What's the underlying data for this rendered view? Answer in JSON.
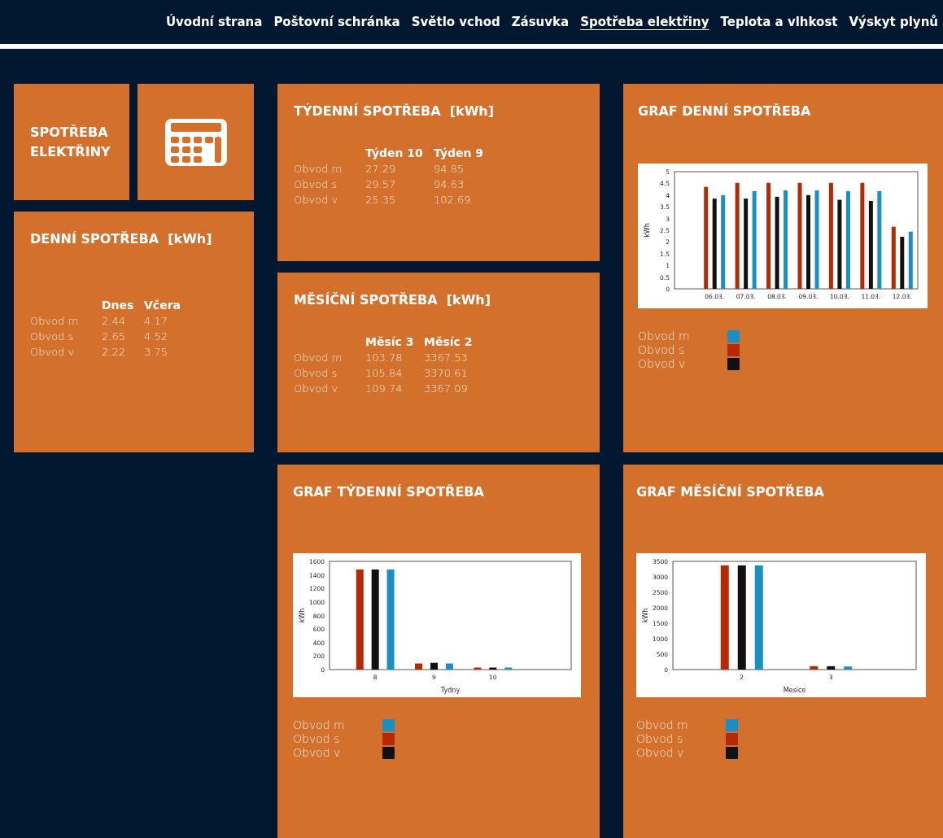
{
  "nav": {
    "items": [
      {
        "label": "Úvodní strana",
        "selected": false
      },
      {
        "label": "Poštovní schránka",
        "selected": false
      },
      {
        "label": "Světlo vchod",
        "selected": false
      },
      {
        "label": "Zásuvka",
        "selected": false
      },
      {
        "label": "Spotřeba elektřiny",
        "selected": true
      },
      {
        "label": "Teplota a vlhkost",
        "selected": false
      },
      {
        "label": "Výskyt plynů",
        "selected": false
      }
    ]
  },
  "page_tile": {
    "title": "SPOTŘEBA ELEKTŘINY"
  },
  "daily": {
    "title": "DENNÍ SPOTŘEBA  [kWh]",
    "columns": [
      "Dnes",
      "Včera"
    ],
    "rows": [
      {
        "label": "Obvod m",
        "values": [
          "2.44",
          "4.17"
        ]
      },
      {
        "label": "Obvod s",
        "values": [
          "2.65",
          "4.52"
        ]
      },
      {
        "label": "Obvod v",
        "values": [
          "2.22",
          "3.75"
        ]
      }
    ]
  },
  "weekly": {
    "title": "TÝDENNÍ SPOTŘEBA  [kWh]",
    "columns": [
      "Týden 10",
      "Týden 9"
    ],
    "rows": [
      {
        "label": "Obvod m",
        "values": [
          "27.29",
          "94.85"
        ]
      },
      {
        "label": "Obvod s",
        "values": [
          "29.57",
          "94.63"
        ]
      },
      {
        "label": "Obvod v",
        "values": [
          "25.35",
          "102.69"
        ]
      }
    ]
  },
  "monthly": {
    "title": "MĚSÍČNÍ SPOTŘEBA  [kWh]",
    "columns": [
      "Měsíc 3",
      "Měsíc 2"
    ],
    "rows": [
      {
        "label": "Obvod m",
        "values": [
          "103.78",
          "3367.53"
        ]
      },
      {
        "label": "Obvod s",
        "values": [
          "105.84",
          "3370.61"
        ]
      },
      {
        "label": "Obvod v",
        "values": [
          "109.74",
          "3367.09"
        ]
      }
    ]
  },
  "daily_chart": {
    "title": "GRAF DENNÍ SPOTŘEBA",
    "chart_data": {
      "type": "bar",
      "ylabel": "kWh",
      "categories": [
        "06.03.",
        "07.03.",
        "08.03.",
        "09.03.",
        "10.03.",
        "11.03.",
        "12.03."
      ],
      "ylim": [
        0,
        5
      ],
      "yticks": [
        0,
        0.5,
        1,
        1.5,
        2,
        2.5,
        3,
        3.5,
        4,
        4.5,
        5
      ],
      "series": [
        {
          "name": "Obvod m",
          "color": "#1a8fc4",
          "values": [
            4.0,
            4.17,
            4.2,
            4.2,
            4.17,
            4.17,
            2.44
          ]
        },
        {
          "name": "Obvod s",
          "color": "#b52a04",
          "values": [
            4.35,
            4.52,
            4.52,
            4.52,
            4.52,
            4.52,
            2.65
          ]
        },
        {
          "name": "Obvod v",
          "color": "#111111",
          "values": [
            3.85,
            3.85,
            3.93,
            4.0,
            3.8,
            3.75,
            2.22
          ]
        }
      ]
    }
  },
  "weekly_chart": {
    "title": "GRAF TÝDENNÍ SPOTŘEBA",
    "chart_data": {
      "type": "bar",
      "xlabel": "Tydny",
      "ylabel": "kWh",
      "categories": [
        "8",
        "9",
        "10"
      ],
      "ylim": [
        0,
        1600
      ],
      "yticks": [
        0,
        200,
        400,
        600,
        800,
        1000,
        1200,
        1400,
        1600
      ],
      "series": [
        {
          "name": "Obvod m",
          "color": "#1a8fc4",
          "values": [
            1480,
            90,
            30
          ]
        },
        {
          "name": "Obvod s",
          "color": "#b52a04",
          "values": [
            1480,
            90,
            30
          ]
        },
        {
          "name": "Obvod v",
          "color": "#111111",
          "values": [
            1480,
            100,
            30
          ]
        }
      ]
    }
  },
  "monthly_chart": {
    "title": "GRAF MĚSÍČNÍ SPOTŘEBA",
    "chart_data": {
      "type": "bar",
      "xlabel": "Mesice",
      "ylabel": "kWh",
      "categories": [
        "2",
        "3"
      ],
      "ylim": [
        0,
        3500
      ],
      "yticks": [
        0,
        500,
        1000,
        1500,
        2000,
        2500,
        3000,
        3500
      ],
      "series": [
        {
          "name": "Obvod m",
          "color": "#1a8fc4",
          "values": [
            3370,
            100
          ]
        },
        {
          "name": "Obvod s",
          "color": "#b52a04",
          "values": [
            3370,
            110
          ]
        },
        {
          "name": "Obvod v",
          "color": "#111111",
          "values": [
            3370,
            110
          ]
        }
      ]
    }
  }
}
